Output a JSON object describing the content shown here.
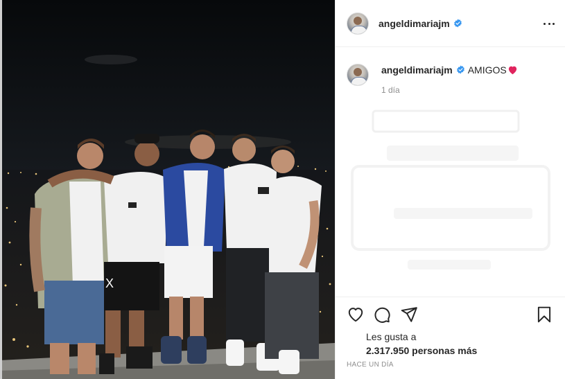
{
  "post": {
    "username": "angeldimariajm",
    "verified": true,
    "more_icon": "more-horizontal-icon"
  },
  "caption": {
    "username": "angeldimariajm",
    "text": "AMIGOS",
    "emoji": "red-heart",
    "time": "1 día"
  },
  "actions": {
    "icons": [
      "heart-icon",
      "comment-icon",
      "share-icon",
      "save-icon"
    ]
  },
  "likes": {
    "prefix": "Les gusta a",
    "count": "2.317.950 personas más"
  },
  "date": "HACE UN DÍA",
  "colors": {
    "verified_blue": "#3897f0",
    "heart_red": "#e0245e",
    "border": "#efefef",
    "muted": "#8e8e8e"
  }
}
